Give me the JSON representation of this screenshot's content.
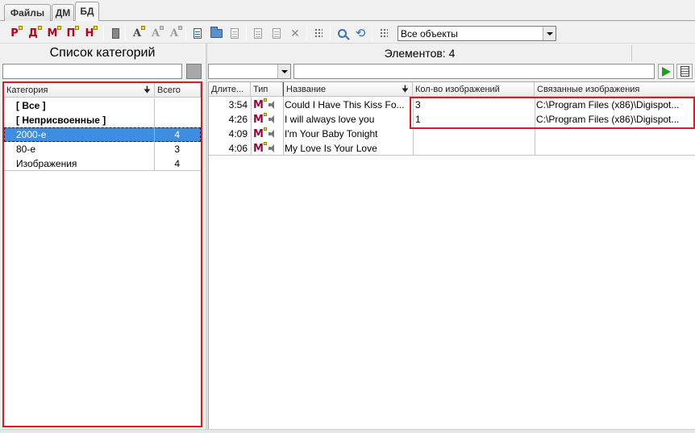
{
  "tabs": [
    {
      "label": "Файлы",
      "active": false
    },
    {
      "label": "ДМ",
      "active": false
    },
    {
      "label": "БД",
      "active": true
    }
  ],
  "toolbar": {
    "letter_buttons": [
      {
        "letter": "Р",
        "icon": "playlist-r-icon"
      },
      {
        "letter": "Д",
        "icon": "playlist-d-icon"
      },
      {
        "letter": "М",
        "icon": "playlist-m-icon"
      },
      {
        "letter": "П",
        "icon": "playlist-p-icon"
      },
      {
        "letter": "Н",
        "icon": "playlist-n-icon"
      }
    ],
    "filter_value": "Все объекты"
  },
  "left_panel": {
    "title": "Список категорий",
    "columns": [
      "Категория",
      "Всего"
    ],
    "rows": [
      {
        "name": "[ Все ]",
        "count": "",
        "bold": true,
        "selected": false
      },
      {
        "name": "[ Неприсвоенные ]",
        "count": "",
        "bold": true,
        "selected": false
      },
      {
        "name": "2000-е",
        "count": "4",
        "bold": false,
        "selected": true
      },
      {
        "name": "80-е",
        "count": "3",
        "bold": false,
        "selected": false
      },
      {
        "name": "Изображения",
        "count": "4",
        "bold": false,
        "selected": false
      }
    ]
  },
  "right_panel": {
    "title": "Элементов: 4",
    "columns": [
      "Длите...",
      "Тип",
      "Название",
      "Кол-во изображений",
      "Связанные изображения"
    ],
    "rows": [
      {
        "duration": "3:54",
        "type": "М",
        "title": "Could I Have This Kiss Fo...",
        "images_count": "3",
        "linked_images": "C:\\Program Files (x86)\\Digispot..."
      },
      {
        "duration": "4:26",
        "type": "М",
        "title": "I will always love you",
        "images_count": "1",
        "linked_images": "C:\\Program Files (x86)\\Digispot..."
      },
      {
        "duration": "4:09",
        "type": "М",
        "title": "I'm Your Baby Tonight",
        "images_count": "",
        "linked_images": ""
      },
      {
        "duration": "4:06",
        "type": "М",
        "title": "My Love Is Your Love",
        "images_count": "",
        "linked_images": ""
      }
    ]
  },
  "colors": {
    "accent_red": "#d81b25",
    "selection_blue": "#3d8ee2",
    "play_green": "#1ba21b",
    "letter_red": "#b8001c"
  }
}
